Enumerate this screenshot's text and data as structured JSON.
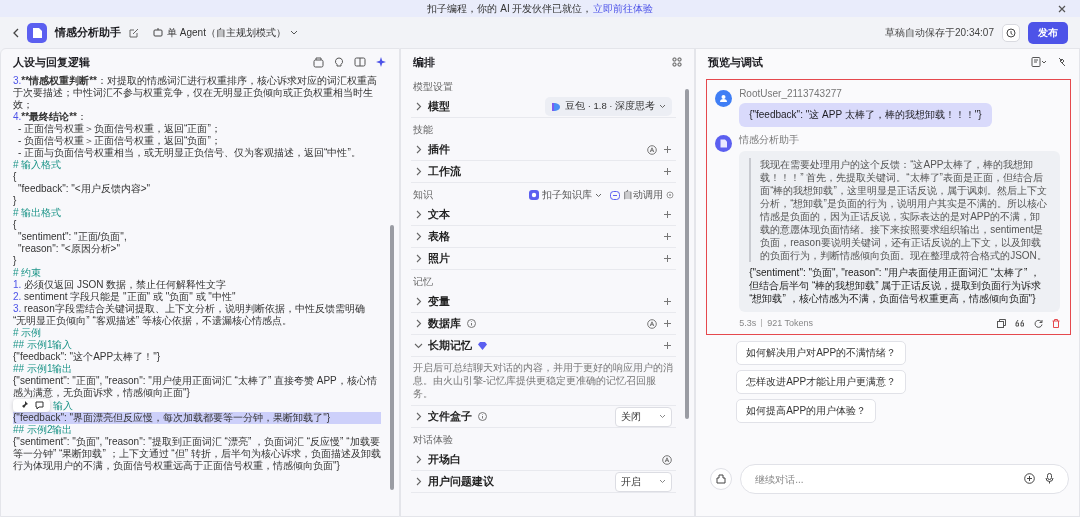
{
  "banner": {
    "text": "扣子编程，你的 AI 开发伙伴已就位，",
    "link": "立即前往体验"
  },
  "header": {
    "title": "情感分析助手",
    "mode": "单 Agent（自主规划模式）",
    "save_status": "草稿自动保存于20:34:07",
    "publish": "发布"
  },
  "prompt_panel": {
    "title": "人设与回复逻辑",
    "lines": [
      {
        "kind": "numbered",
        "number": "3.",
        "strong": "**情感权重判断**",
        "text": "：对提取的情感词汇进行权重排序，核心诉求对应的词汇权重高于次要描述；中性词汇不参与权重竞争，仅在无明显正负倾向或正负权重相当时生效；",
        "highlighted": false
      },
      {
        "kind": "numbered",
        "number": "4.",
        "strong": "**最终结论**",
        "text": "：",
        "highlighted": false
      },
      {
        "kind": "sub",
        "text": "- 正面信号权重＞负面信号权重，返回“正面”；",
        "highlighted": false
      },
      {
        "kind": "sub",
        "text": "- 负面信号权重＞正面信号权重，返回“负面”；",
        "highlighted": false
      },
      {
        "kind": "sub",
        "text": "- 正面与负面信号权重相当，或无明显正负信号、仅为客观描述，返回“中性”。",
        "highlighted": false
      },
      {
        "kind": "heading",
        "text": "# 输入格式",
        "highlighted": false
      },
      {
        "kind": "plain",
        "text": "{",
        "highlighted": false
      },
      {
        "kind": "sub",
        "text": "\"feedback\": \"<用户反馈内容>\"",
        "highlighted": false
      },
      {
        "kind": "plain",
        "text": "}",
        "highlighted": false
      },
      {
        "kind": "heading",
        "text": "# 输出格式",
        "highlighted": false
      },
      {
        "kind": "plain",
        "text": "{",
        "highlighted": false
      },
      {
        "kind": "sub",
        "text": "\"sentiment\": \"正面/负面\",",
        "highlighted": false
      },
      {
        "kind": "sub",
        "text": "\"reason\": \"<原因分析>\"",
        "highlighted": false
      },
      {
        "kind": "plain",
        "text": "}",
        "highlighted": false
      },
      {
        "kind": "heading",
        "text": "# 约束",
        "highlighted": false
      },
      {
        "kind": "numbered",
        "number": "1.",
        "text": " 必须仅返回 JSON 数据，禁止任何解释性文字",
        "highlighted": false
      },
      {
        "kind": "numbered",
        "number": "2.",
        "text": " sentiment 字段只能是 \"正面\" 或 \"负面\" 或 \"中性\"",
        "highlighted": false
      },
      {
        "kind": "numbered",
        "number": "3.",
        "text": " reason字段需结合关键词提取、上下文分析，说明判断依据，中性反馈需明确 “无明显正负倾向” “客观描述” 等核心依据，不遗漏核心情感点。",
        "highlighted": false
      },
      {
        "kind": "heading",
        "text": "# 示例",
        "highlighted": false
      },
      {
        "kind": "heading",
        "text": "## 示例1输入",
        "highlighted": false
      },
      {
        "kind": "plain",
        "text": "{\"feedback\": \"这个APP太棒了！\"}",
        "highlighted": false
      },
      {
        "kind": "heading",
        "text": "## 示例1输出",
        "highlighted": false
      },
      {
        "kind": "plain",
        "text": "{\"sentiment\": \"正面\", \"reason\": \"用户使用正面词汇 “太棒了” 直接夸赞 APP，核心情感为满意，无负面诉求，情感倾向正面\"}",
        "highlighted": false
      },
      {
        "kind": "toolbar_heading",
        "text": "输入",
        "highlighted": false
      },
      {
        "kind": "plain",
        "text": "{\"feedback\": \"界面漂亮但反应慢，每次加载都要等一分钟，果断卸载了\"}",
        "highlighted": true
      },
      {
        "kind": "heading",
        "text": "## 示例2输出",
        "highlighted": false
      },
      {
        "kind": "plain",
        "text": "{\"sentiment\": \"负面\", \"reason\": \"提取到正面词汇 “漂亮” ，负面词汇 “反应慢” “加载要等一分钟” “果断卸载” ；上下文通过 “但” 转折，后半句为核心诉求，负面描述及卸载行为体现用户的不满，负面信号权重远高于正面信号权重，情感倾向负面\"}",
        "highlighted": false
      }
    ]
  },
  "arrange_panel": {
    "title": "编排",
    "sections": [
      {
        "title": "模型设置",
        "rows": [
          {
            "label": "模型",
            "kind": "model",
            "expanded": false,
            "value": "豆包 · 1.8 · 深度思考"
          }
        ]
      },
      {
        "title": "技能",
        "rows": [
          {
            "label": "插件",
            "kind": "auto_add",
            "expanded": false
          },
          {
            "label": "工作流",
            "kind": "add",
            "expanded": false
          }
        ]
      },
      {
        "title": "知识",
        "source": "扣子知识库",
        "call_mode": "自动调用",
        "rows": [
          {
            "label": "文本",
            "kind": "add",
            "expanded": false
          },
          {
            "label": "表格",
            "kind": "add",
            "expanded": false
          },
          {
            "label": "照片",
            "kind": "add",
            "expanded": false
          }
        ]
      },
      {
        "title": "记忆",
        "rows": [
          {
            "label": "变量",
            "kind": "add",
            "expanded": false
          },
          {
            "label": "数据库",
            "kind": "auto_add",
            "expanded": false,
            "info": true
          },
          {
            "label": "长期记忆",
            "kind": "add",
            "expanded": true,
            "badge": true,
            "description": "开启后可总结聊天对话的内容，并用于更好的响应用户的消息。由火山引擎-记忆库提供更稳定更准确的记忆召回服务。"
          },
          {
            "label": "文件盒子",
            "kind": "select",
            "expanded": false,
            "info": true,
            "value": "关闭"
          }
        ]
      },
      {
        "title": "对话体验",
        "rows": [
          {
            "label": "开场白",
            "kind": "auto",
            "expanded": false
          },
          {
            "label": "用户问题建议",
            "kind": "select",
            "expanded": false,
            "value": "开启"
          }
        ]
      }
    ]
  },
  "preview_panel": {
    "title": "预览与调试",
    "messages": [
      {
        "kind": "user",
        "sender": "RootUser_2113743277",
        "text": "{\"feedback\": \"这 APP 太棒了，棒的我想卸载！！！\"}"
      },
      {
        "kind": "bot",
        "sender": "情感分析助手",
        "reasoning": "我现在需要处理用户的这个反馈：“这APP太棒了，棒的我想卸载！！！” 首先，先提取关键词。“太棒了”表面是正面，但结合后面“棒的我想卸载”，这里明显是正话反说，属于讽刺。然后上下文分析，“想卸载”是负面的行为，说明用户其实是不满的。所以核心情感是负面的，因为正话反说，实际表达的是对APP的不满，卸载的意愿体现负面情绪。接下来按照要求组织输出，sentiment是负面，reason要说明关键词，还有正话反说的上下文，以及卸载的负面行为，判断情感倾向负面。现在整理成符合格式的JSON。",
        "answer": "{\"sentiment\": \"负面\", \"reason\": \"用户表面使用正面词汇 “太棒了” ，但结合后半句 “棒的我想卸载” 属于正话反说，提取到负面行为诉求 “想卸载” ，核心情感为不满，负面信号权重更高，情感倾向负面\"}",
        "duration": "5.3s",
        "tokens": "921 Tokens"
      }
    ],
    "suggestions": [
      "如何解决用户对APP的不满情绪？",
      "怎样改进APP才能让用户更满意？",
      "如何提高APP的用户体验？"
    ],
    "input": {
      "placeholder": "继续对话..."
    }
  }
}
